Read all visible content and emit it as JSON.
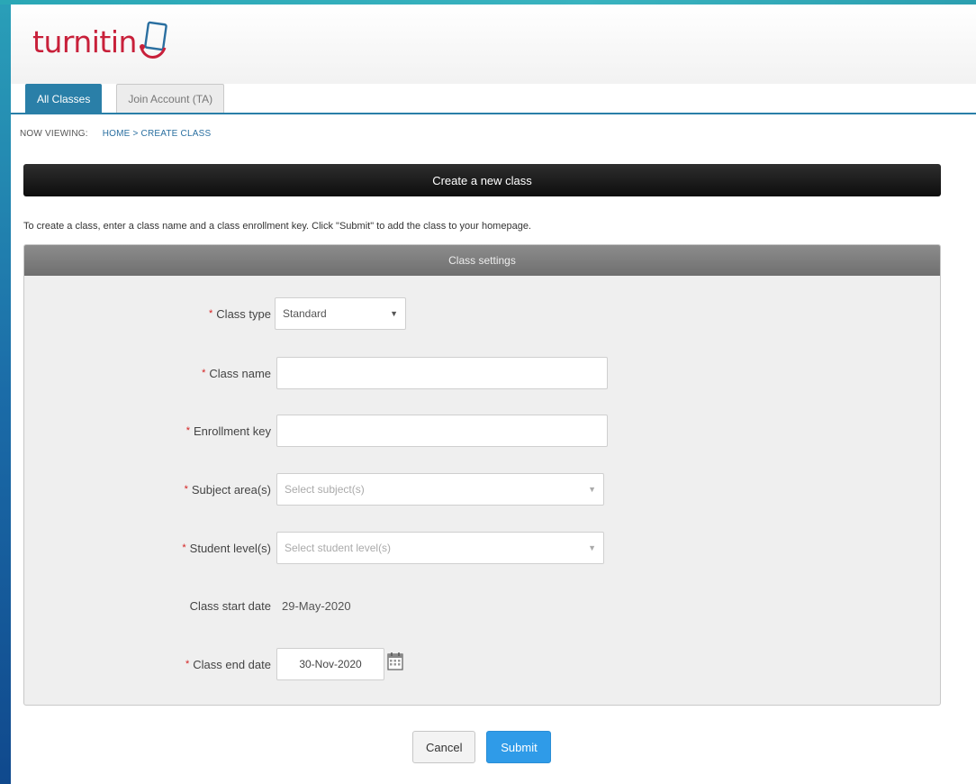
{
  "brand": {
    "logo_text": "turnitin",
    "logo_color": "#c8203a"
  },
  "tabs": [
    {
      "label": "All Classes",
      "active": true
    },
    {
      "label": "Join Account (TA)",
      "active": false
    }
  ],
  "breadcrumb": {
    "prefix": "NOW VIEWING:",
    "path": "HOME > CREATE CLASS"
  },
  "page_title": "Create a new class",
  "instructions": "To create a class, enter a class name and a class enrollment key. Click \"Submit\" to add the class to your homepage.",
  "panel": {
    "title": "Class settings",
    "fields": {
      "class_type": {
        "required": "*",
        "label": "Class type",
        "value": "Standard"
      },
      "class_name": {
        "required": "*",
        "label": "Class name",
        "value": ""
      },
      "enrollment_key": {
        "required": "*",
        "label": "Enrollment key",
        "value": ""
      },
      "subject_areas": {
        "required": "*",
        "label": "Subject area(s)",
        "placeholder": "Select subject(s)"
      },
      "student_levels": {
        "required": "*",
        "label": "Student level(s)",
        "placeholder": "Select student level(s)"
      },
      "start_date": {
        "label": "Class start date",
        "value": "29-May-2020"
      },
      "end_date": {
        "required": "*",
        "label": "Class end date",
        "value": "30-Nov-2020"
      }
    }
  },
  "actions": {
    "cancel": "Cancel",
    "submit": "Submit"
  },
  "colors": {
    "accent": "#2a7fa8",
    "submit": "#2f9be8",
    "required": "#d42020"
  },
  "icons": {
    "calendar": "calendar-icon",
    "dropdown": "chevron-down-icon"
  }
}
